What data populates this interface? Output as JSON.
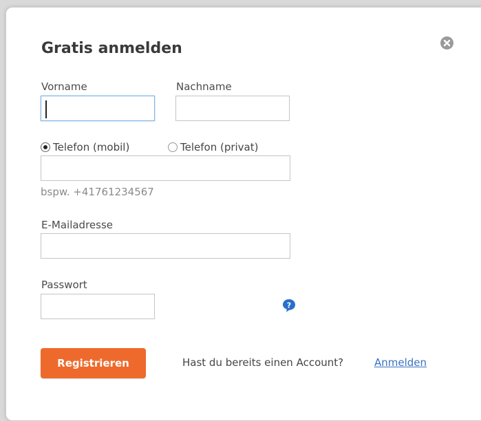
{
  "dialog": {
    "title": "Gratis anmelden"
  },
  "form": {
    "first_name": {
      "label": "Vorname",
      "value": ""
    },
    "last_name": {
      "label": "Nachname",
      "value": ""
    },
    "phone_type": {
      "options": [
        "Telefon (mobil)",
        "Telefon (privat)"
      ],
      "selected": "Telefon (mobil)"
    },
    "phone": {
      "value": "",
      "hint": "bspw. +41761234567"
    },
    "email": {
      "label": "E-Mailadresse",
      "value": ""
    },
    "password": {
      "label": "Passwort",
      "value": ""
    }
  },
  "actions": {
    "register_label": "Registrieren",
    "account_question": "Hast du bereits einen Account?",
    "login_link": "Anmelden"
  },
  "icons": {
    "close": "close-icon",
    "help": "help-icon"
  },
  "colors": {
    "accent": "#ee6a2c",
    "link": "#3a72c4",
    "help_icon": "#2a6fc9"
  }
}
